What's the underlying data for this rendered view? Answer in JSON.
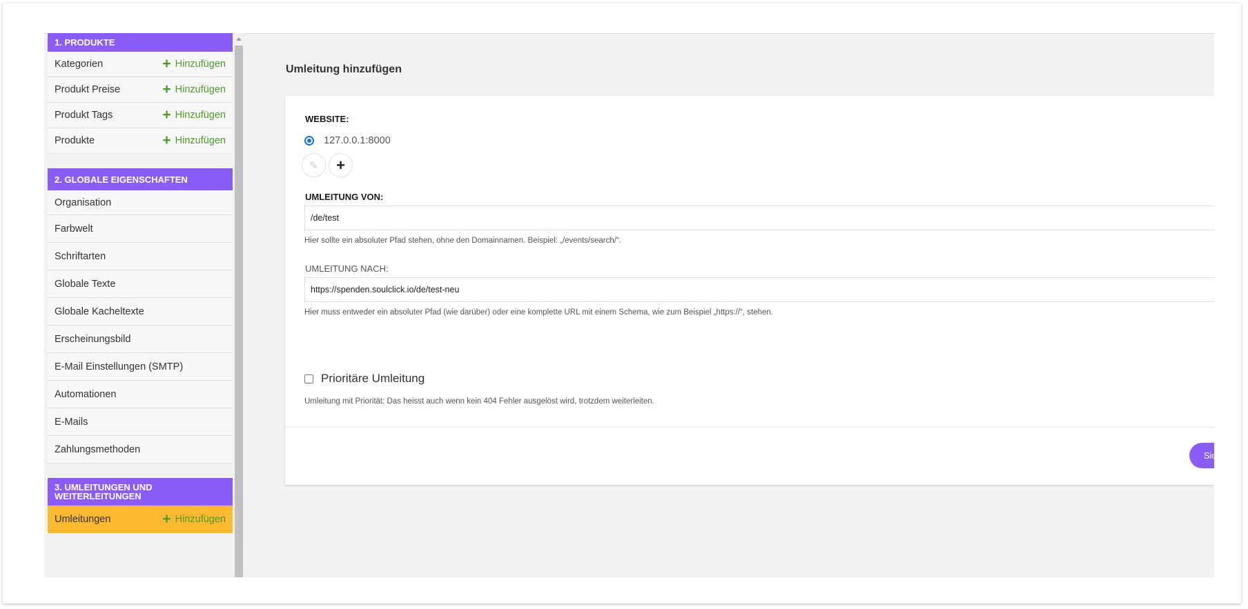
{
  "sidebar": {
    "sections": [
      {
        "title": "1. PRODUKTE",
        "items": [
          {
            "label": "Kategorien",
            "add": "Hinzufügen"
          },
          {
            "label": "Produkt Preise",
            "add": "Hinzufügen"
          },
          {
            "label": "Produkt Tags",
            "add": "Hinzufügen"
          },
          {
            "label": "Produkte",
            "add": "Hinzufügen"
          }
        ]
      },
      {
        "title": "2. GLOBALE EIGENSCHAFTEN",
        "items": [
          {
            "label": "Organisation"
          },
          {
            "label": "Farbwelt"
          },
          {
            "label": "Schriftarten"
          },
          {
            "label": "Globale Texte"
          },
          {
            "label": "Globale Kacheltexte"
          },
          {
            "label": "Erscheinungsbild"
          },
          {
            "label": "E-Mail Einstellungen (SMTP)"
          },
          {
            "label": "Automationen"
          },
          {
            "label": "E-Mails"
          },
          {
            "label": "Zahlungsmethoden"
          }
        ]
      },
      {
        "title": "3. UMLEITUNGEN UND WEITERLEITUNGEN",
        "items": [
          {
            "label": "Umleitungen",
            "add": "Hinzufügen",
            "active": true
          }
        ]
      }
    ]
  },
  "main": {
    "title": "Umleitung hinzufügen",
    "website_label": "WEBSITE:",
    "website_option": "127.0.0.1:8000",
    "from_label": "UMLEITUNG VON:",
    "from_value": "/de/test",
    "from_help": "Hier sollte ein absoluter Pfad stehen, ohne den Domainnamen. Beispiel: „/events/search/“.",
    "to_label": "UMLEITUNG NACH:",
    "to_value": "https://spenden.soulclick.io/de/test-neu",
    "to_help": "Hier muss entweder ein absoluter Pfad (wie darüber) oder eine komplette URL mit einem Schema, wie zum Beispiel „https://“, stehen.",
    "priority_label": "Prioritäre Umleitung",
    "priority_help": "Umleitung mit Priorität: Das heisst auch wenn kein 404 Fehler ausgelöst wird, trotzdem weiterleiten.",
    "save_label": "Sichern"
  },
  "colors": {
    "accent": "#8c5cf6",
    "active_item": "#fbb932",
    "add_link": "#4f9a2a"
  }
}
